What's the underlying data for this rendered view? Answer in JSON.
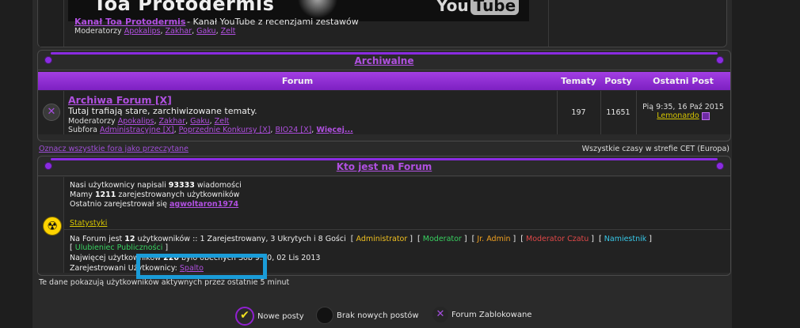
{
  "yt_block": {
    "banner_title": "Toa Protodermis",
    "banner_logo": "YouTube",
    "banner_logo_tube": "Tube",
    "banner_logo_you": "You",
    "link": "Kanał Toa Protodermis",
    "description": "- Kanał YouTube z recenzjami zestawów",
    "mods_label": "Moderatorzy",
    "mods": [
      "Apokalips",
      "Zakhar",
      "Gaku",
      "Zelt"
    ]
  },
  "archive": {
    "category_title": "Archiwalne",
    "headers": {
      "forum": "Forum",
      "topics": "Tematy",
      "posts": "Posty",
      "last_post": "Ostatni Post"
    },
    "forum": {
      "title": "Archiwa Forum [X]",
      "description": "Tutaj trafiają stare, zarchiwizowane tematy.",
      "mods_label": "Moderatorzy",
      "mods": [
        "Apokalips",
        "Zakhar",
        "Gaku",
        "Zelt"
      ],
      "subforums_label": "Subfora",
      "subforums": [
        "Administracyjne [X]",
        "Poprzednie Konkursy [X]",
        "BIO24 [X]",
        "Więcej..."
      ],
      "topics": "197",
      "posts": "11651",
      "last_post_date": "Pią 9:35, 16 Paź 2015",
      "last_post_user": "Lemonardo"
    }
  },
  "mark_all": "Oznacz wszystkie fora jako przeczytane",
  "timezone": "Wszystkie czasy w strefie CET (Europa)",
  "online": {
    "category_title": "Kto jest na Forum",
    "posts_pre": "Nasi użytkownicy napisali",
    "posts_count": "93333",
    "posts_post": "wiadomości",
    "users_pre": "Mamy",
    "users_count": "1211",
    "users_post": "zarejestrowanych użytkowników",
    "last_reg_pre": "Ostatnio zarejestrował się",
    "last_reg_user": "agwoltaron1974",
    "stats_link": "Statystyki",
    "now_pre": "Na Forum jest",
    "now_count": "12",
    "now_post": "użytkowników :: 1 Zarejestrowany, 3 Ukrytych i 8 Gości",
    "roles": [
      "Administrator",
      "Moderator",
      "Jr. Admin",
      "Moderator Czatu",
      "Namiestnik",
      "Ulubieniec Publiczności"
    ],
    "max_pre": "Najwięcej użytkowników",
    "max_count": "220",
    "max_post": "było obecnych Sob 9:20, 02 Lis 2013",
    "registered_label": "Zarejestrowani Użytkownicy:",
    "registered_user": "Spalto"
  },
  "note": "Te dane pokazują użytkowników aktywnych przez ostatnie 5 minut",
  "legend": {
    "new_posts": "Nowe posty",
    "no_new_posts": "Brak nowych postów",
    "locked": "Forum Zablokowane"
  },
  "colors": {
    "accent": "#8a2be2",
    "link": "#b050e0",
    "highlight_box": "#1a9cd8"
  }
}
